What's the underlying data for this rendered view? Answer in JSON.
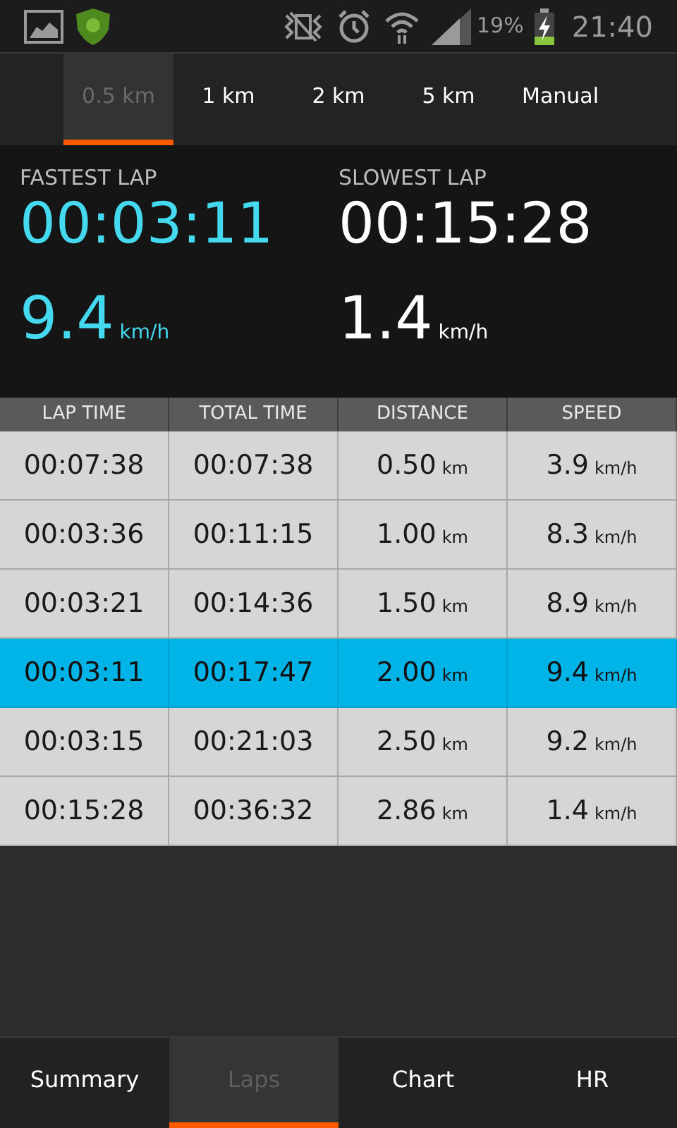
{
  "status_bar": {
    "battery_percent": "19%",
    "time": "21:40"
  },
  "interval_tabs": [
    {
      "label": "0.5 km",
      "selected": true
    },
    {
      "label": "1 km",
      "selected": false
    },
    {
      "label": "2 km",
      "selected": false
    },
    {
      "label": "5 km",
      "selected": false
    },
    {
      "label": "Manual",
      "selected": false
    }
  ],
  "stats": [
    {
      "label": "FASTEST LAP",
      "time": "00:03:11",
      "speed": "9.4",
      "unit": "km/h",
      "color": "#44d9ef"
    },
    {
      "label": "SLOWEST LAP",
      "time": "00:15:28",
      "speed": "1.4",
      "unit": "km/h",
      "color": "#ffffff"
    }
  ],
  "table": {
    "columns": [
      "LAP TIME",
      "TOTAL TIME",
      "DISTANCE",
      "SPEED"
    ],
    "rows": [
      {
        "lap_time": "00:07:38",
        "total_time": "00:07:38",
        "distance": "0.50",
        "distance_unit": "km",
        "speed": "3.9",
        "speed_unit": "km/h",
        "selected": false
      },
      {
        "lap_time": "00:03:36",
        "total_time": "00:11:15",
        "distance": "1.00",
        "distance_unit": "km",
        "speed": "8.3",
        "speed_unit": "km/h",
        "selected": false
      },
      {
        "lap_time": "00:03:21",
        "total_time": "00:14:36",
        "distance": "1.50",
        "distance_unit": "km",
        "speed": "8.9",
        "speed_unit": "km/h",
        "selected": false
      },
      {
        "lap_time": "00:03:11",
        "total_time": "00:17:47",
        "distance": "2.00",
        "distance_unit": "km",
        "speed": "9.4",
        "speed_unit": "km/h",
        "selected": true
      },
      {
        "lap_time": "00:03:15",
        "total_time": "00:21:03",
        "distance": "2.50",
        "distance_unit": "km",
        "speed": "9.2",
        "speed_unit": "km/h",
        "selected": false
      },
      {
        "lap_time": "00:15:28",
        "total_time": "00:36:32",
        "distance": "2.86",
        "distance_unit": "km",
        "speed": "1.4",
        "speed_unit": "km/h",
        "selected": false
      }
    ]
  },
  "bottom_tabs": [
    {
      "label": "Summary",
      "selected": false
    },
    {
      "label": "Laps",
      "selected": true
    },
    {
      "label": "Chart",
      "selected": false
    },
    {
      "label": "HR",
      "selected": false
    }
  ]
}
